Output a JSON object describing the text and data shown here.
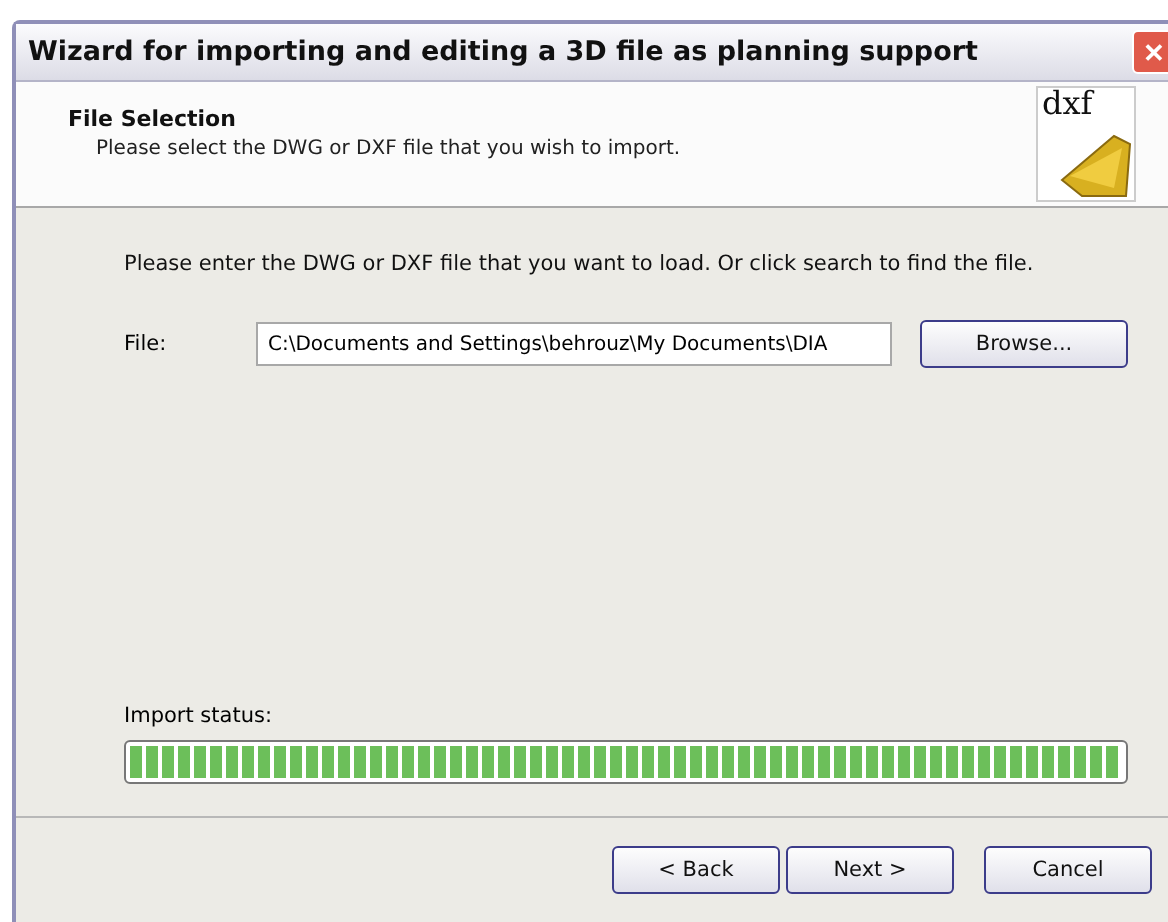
{
  "window": {
    "title": "Wizard for importing and editing a 3D file as planning support",
    "close_glyph": "✕"
  },
  "header": {
    "title": "File Selection",
    "subtitle": "Please select the DWG or DXF file that you wish to import.",
    "logo_text": "dxf"
  },
  "instruction": "Please enter the DWG or DXF file that you want to load. Or click search to find the file.",
  "file": {
    "label": "File:",
    "value": "C:\\Documents and Settings\\behrouz\\My Documents\\DIA",
    "browse": "Browse..."
  },
  "import_status": {
    "label": "Import status:",
    "level": 1
  },
  "buttons": [
    {
      "label": "< Back",
      "kind": "back"
    },
    {
      "label": "Next >",
      "kind": "next"
    },
    {
      "label": "Cancel",
      "kind": "cancel"
    }
  ]
}
